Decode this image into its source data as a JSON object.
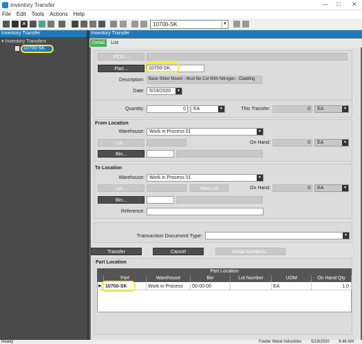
{
  "window": {
    "title": "Inventory Transfer"
  },
  "menu": [
    "File",
    "Edit",
    "Tools",
    "Actions",
    "Help"
  ],
  "toolbar": {
    "part_value": "10700-SK"
  },
  "left_panel": {
    "header": "Inventory Transfer",
    "tree_root": "Inventory Transfers",
    "tree_item": "10700-SK"
  },
  "right_panel": {
    "header": "Inventory Transfer"
  },
  "tabs": [
    "Detail",
    "List"
  ],
  "form": {
    "pcid_label": "PCID...",
    "part_label": "Part...",
    "part_value": "10700-SK",
    "description_label": "Description:",
    "description_value": "Base Slider Mount - Must Be Cut With Nitrogen - Cladding",
    "date_label": "Date:",
    "date_value": "5/19/2020",
    "quantity_label": "Quantity:",
    "quantity_value": "0",
    "quantity_uom": "EA",
    "this_transfer_label": "This Transfer:",
    "this_transfer_value": "0",
    "this_transfer_uom": "EA",
    "from_location_title": "From Location",
    "from_warehouse_label": "Warehouse:",
    "from_warehouse_value": "Work in Process 01",
    "from_lot_label": "Lot...",
    "from_onhand_label": "On Hand:",
    "from_onhand_value": "0",
    "from_onhand_uom": "EA",
    "from_bin_label": "Bin...",
    "to_location_title": "To Location",
    "to_warehouse_label": "Warehouse:",
    "to_warehouse_value": "Work in Process 01",
    "to_lot_label": "Lot...",
    "next_lot_label": "Next Lot",
    "to_onhand_label": "On Hand:",
    "to_onhand_value": "0",
    "to_onhand_uom": "EA",
    "to_bin_label": "Bin...",
    "reference_label": "Reference:",
    "transaction_doc_label": "Transaction Document Type:",
    "transfer_button": "Transfer",
    "cancel_button": "Cancel",
    "serial_button": "Serial Numbers..."
  },
  "part_location": {
    "section_title": "Part Location",
    "grid_caption": "Part Location",
    "columns": [
      "Part",
      "Warehouse",
      "Bin",
      "Lot Number",
      "UOM",
      "On Hand Qty"
    ],
    "row": [
      "10700-SK",
      "Work in Process",
      "00-00-00",
      "",
      "EA",
      "1.0"
    ]
  },
  "status": {
    "left": "Ready",
    "company": "Fowler Metal Industries",
    "date": "5/19/2020",
    "time": "9:46 AM"
  },
  "colors": {
    "accent": "#1f7ab8",
    "highlight": "#f5ea2a",
    "dark_button": "#4e4e4e"
  }
}
